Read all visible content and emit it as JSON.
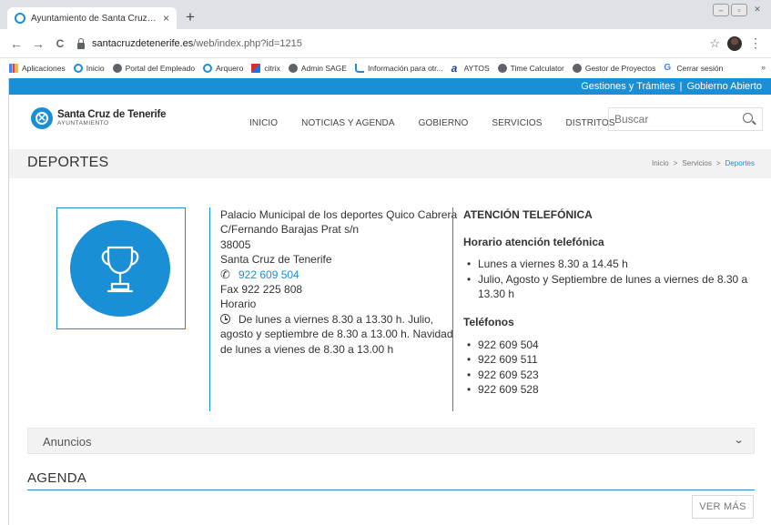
{
  "browser": {
    "tab_title": "Ayuntamiento de Santa Cruz de Ter",
    "tab_close": "×",
    "new_tab": "+",
    "url_host": "santacruzdetenerife.es",
    "url_path": "/web/index.php?id=1215",
    "back": "←",
    "forward": "→",
    "reload": "C",
    "star": "☆",
    "menu": "⋮",
    "bookmarks": [
      {
        "label": "Aplicaciones",
        "icon": "apps-grid-icon"
      },
      {
        "label": "Inicio",
        "icon": "ring-icon"
      },
      {
        "label": "Portal del Empleado",
        "icon": "globe-icon"
      },
      {
        "label": "Arquero",
        "icon": "ring-icon"
      },
      {
        "label": "citrix",
        "icon": "citrix-icon"
      },
      {
        "label": "Admin SAGE",
        "icon": "globe-icon"
      },
      {
        "label": "Información para otr...",
        "icon": "feed-icon"
      },
      {
        "label": "AYTOS",
        "icon": "aytos-icon"
      },
      {
        "label": "Time Calculator",
        "icon": "globe-icon"
      },
      {
        "label": "Gestor de Proyectos",
        "icon": "globe-icon"
      },
      {
        "label": "Cerrar sesión",
        "icon": "google-icon"
      }
    ],
    "bookmarks_more": "»",
    "aytos_glyph": "a",
    "google_glyph": "G"
  },
  "site": {
    "topband": {
      "gestiones": "Gestiones y Trámites",
      "separator": "|",
      "gobierno_abierto": "Gobierno Abierto"
    },
    "logo": {
      "name": "Santa Cruz de Tenerife",
      "sub": "AYUNTAMIENTO"
    },
    "nav": [
      "INICIO",
      "NOTICIAS Y AGENDA",
      "GOBIERNO",
      "SERVICIOS",
      "DISTRITOS"
    ],
    "search_placeholder": "Buscar",
    "page_title": "DEPORTES",
    "breadcrumb": {
      "inicio": "Inicio",
      "servicios": "Servicios",
      "deportes": "Deportes",
      "sep": ">"
    },
    "address": {
      "line1": "Palacio Municipal de los deportes Quico Cabrera",
      "line2": "C/Fernando Barajas Prat s/n",
      "cp": "38005",
      "city": "Santa Cruz de Tenerife",
      "phone": "922 609 504",
      "fax": "Fax  922 225 808",
      "horario_label": "Horario",
      "horario": "De lunes a viernes 8.30 a 13.30 h. Julio, agosto y septiembre de 8.30 a 13.00 h. Navidad de lunes a vienes de 8.30 a 13.00 h"
    },
    "atencion": {
      "title": "ATENCIÓN TELEFÓNICA",
      "horario_title": "Horario atención telefónica",
      "horario_items": [
        "Lunes a viernes 8.30 a 14.45 h",
        "Julio, Agosto y Septiembre de lunes a viernes de 8.30 a 13.30 h"
      ],
      "telefonos_title": "Teléfonos",
      "telefonos": [
        "922 609 504",
        "922 609 511",
        "922 609 523",
        "922 609 528"
      ]
    },
    "anuncios": "Anuncios",
    "agenda": "AGENDA",
    "ver_mas": "VER MÁS"
  },
  "colors": {
    "brand_blue": "#1a8fd6"
  }
}
